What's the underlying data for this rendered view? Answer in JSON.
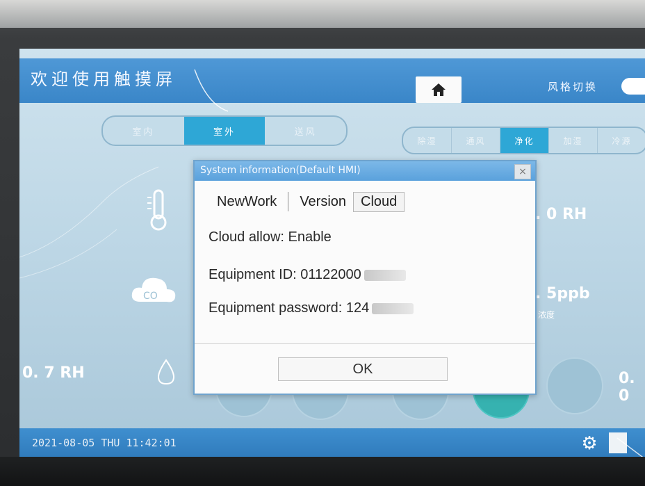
{
  "header": {
    "welcome": "欢迎使用触摸屏",
    "style_switch": "风格切换"
  },
  "mode_tabs": [
    "室内",
    "室外",
    "送风"
  ],
  "function_tabs": [
    "除湿",
    "通风",
    "净化",
    "加湿",
    "冷源"
  ],
  "background_values": {
    "rh_right": ". 0 RH",
    "ppb_right": ". 5ppb",
    "ppb_sub": "浓度",
    "rh_left": "0. 7 RH",
    "right_bottom": "0. 0",
    "co2_label": "CO2"
  },
  "status_bar": {
    "clock": "2021-08-05 THU 11:42:01"
  },
  "dialog": {
    "title": "System information(Default HMI)",
    "close_label": "×",
    "tabs": [
      "NewWork",
      "Version",
      "Cloud"
    ],
    "active_tab": "Cloud",
    "cloud_allow": "Cloud allow: Enable",
    "equipment_id": "Equipment ID: 01122000",
    "equipment_password": "Equipment password: 124",
    "ok_label": "OK"
  },
  "icons": {
    "home": "home-icon",
    "gear": "gear-icon",
    "doc": "document-icon",
    "thermometer": "thermometer-icon",
    "cloud": "cloud-co2-icon",
    "drop": "water-drop-icon"
  },
  "colors": {
    "header_blue": "#3a86c8",
    "active_tab": "#2ea7d6",
    "dialog_title": "#5aa1dc",
    "teal_button": "#36b2b0"
  }
}
